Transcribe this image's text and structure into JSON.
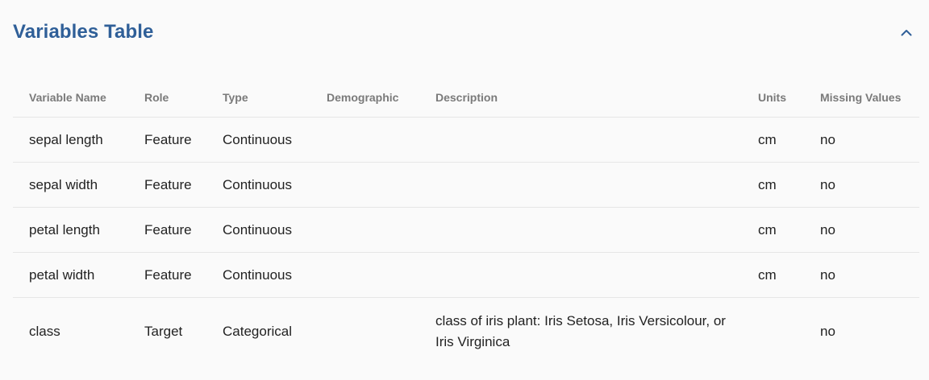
{
  "header": {
    "title": "Variables Table",
    "collapse_icon": "chevron-up-icon"
  },
  "table": {
    "columns": [
      "Variable Name",
      "Role",
      "Type",
      "Demographic",
      "Description",
      "Units",
      "Missing Values"
    ],
    "rows": [
      [
        "sepal length",
        "Feature",
        "Continuous",
        "",
        "",
        "cm",
        "no"
      ],
      [
        "sepal width",
        "Feature",
        "Continuous",
        "",
        "",
        "cm",
        "no"
      ],
      [
        "petal length",
        "Feature",
        "Continuous",
        "",
        "",
        "cm",
        "no"
      ],
      [
        "petal width",
        "Feature",
        "Continuous",
        "",
        "",
        "cm",
        "no"
      ],
      [
        "class",
        "Target",
        "Categorical",
        "",
        "class of iris plant: Iris Setosa, Iris Versicolour, or Iris Virginica",
        "",
        "no"
      ]
    ]
  },
  "colors": {
    "title": "#2f5f98",
    "header_text": "#7a7a7a",
    "row_border": "#e6e6e6",
    "background": "#fafafa"
  }
}
